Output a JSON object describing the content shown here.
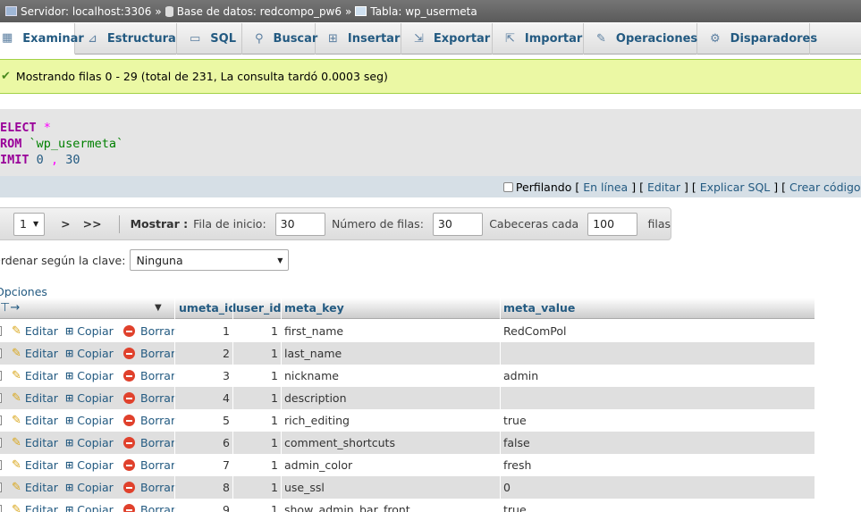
{
  "breadcrumb": {
    "server": "Servidor: localhost:3306",
    "database": "Base de datos: redcompo_pw6",
    "table": "Tabla: wp_usermeta",
    "separator": "»"
  },
  "tabs": [
    {
      "label": "Examinar",
      "icon": "browse-icon",
      "glyph": "▦"
    },
    {
      "label": "Estructura",
      "icon": "structure-icon",
      "glyph": "⊿"
    },
    {
      "label": "SQL",
      "icon": "sql-icon",
      "glyph": "▭"
    },
    {
      "label": "Buscar",
      "icon": "search-icon",
      "glyph": "⚲"
    },
    {
      "label": "Insertar",
      "icon": "insert-icon",
      "glyph": "⊞"
    },
    {
      "label": "Exportar",
      "icon": "export-icon",
      "glyph": "⇲"
    },
    {
      "label": "Importar",
      "icon": "import-icon",
      "glyph": "⇱"
    },
    {
      "label": "Operaciones",
      "icon": "wrench-icon",
      "glyph": "✎"
    },
    {
      "label": "Disparadores",
      "icon": "triggers-icon",
      "glyph": "⚙"
    }
  ],
  "message": "Mostrando filas 0 - 29 (total de 231, La consulta tardó 0.0003 seg)",
  "sql": {
    "line1_kw": "ELECT",
    "line1_rest": "*",
    "line2_kw": "ROM",
    "line2_rest": "`wp_usermeta`",
    "line3_kw": "IMIT",
    "line3_a": "0",
    "line3_sep": ",",
    "line3_b": "30"
  },
  "sql_links": {
    "profiling": "Perfilando",
    "inline": "En línea",
    "edit": "Editar",
    "explain": "Explicar SQL",
    "create_code": "Crear código PHP",
    "lb": "[",
    "rb": "]"
  },
  "nav": {
    "page_value": "1",
    "next": ">",
    "last": ">>",
    "show_label": "Mostrar :",
    "start_label": "Fila de inicio:",
    "start_value": "30",
    "rows_label": "Número de filas:",
    "rows_value": "30",
    "headers_label": "Cabeceras cada",
    "headers_value": "100",
    "rows_suffix": "filas"
  },
  "sort": {
    "label": "Ordenar según la clave:",
    "value": "Ninguna"
  },
  "options_label": "Opciones",
  "table": {
    "columns": [
      "umeta_id",
      "user_id",
      "meta_key",
      "meta_value"
    ],
    "action_labels": {
      "edit": "Editar",
      "copy": "Copiar",
      "delete": "Borrar"
    },
    "rows": [
      {
        "umeta_id": "1",
        "user_id": "1",
        "meta_key": "first_name",
        "meta_value": "RedComPol"
      },
      {
        "umeta_id": "2",
        "user_id": "1",
        "meta_key": "last_name",
        "meta_value": ""
      },
      {
        "umeta_id": "3",
        "user_id": "1",
        "meta_key": "nickname",
        "meta_value": "admin"
      },
      {
        "umeta_id": "4",
        "user_id": "1",
        "meta_key": "description",
        "meta_value": ""
      },
      {
        "umeta_id": "5",
        "user_id": "1",
        "meta_key": "rich_editing",
        "meta_value": "true"
      },
      {
        "umeta_id": "6",
        "user_id": "1",
        "meta_key": "comment_shortcuts",
        "meta_value": "false"
      },
      {
        "umeta_id": "7",
        "user_id": "1",
        "meta_key": "admin_color",
        "meta_value": "fresh"
      },
      {
        "umeta_id": "8",
        "user_id": "1",
        "meta_key": "use_ssl",
        "meta_value": "0"
      },
      {
        "umeta_id": "9",
        "user_id": "1",
        "meta_key": "show_admin_bar_front",
        "meta_value": "true"
      }
    ]
  }
}
